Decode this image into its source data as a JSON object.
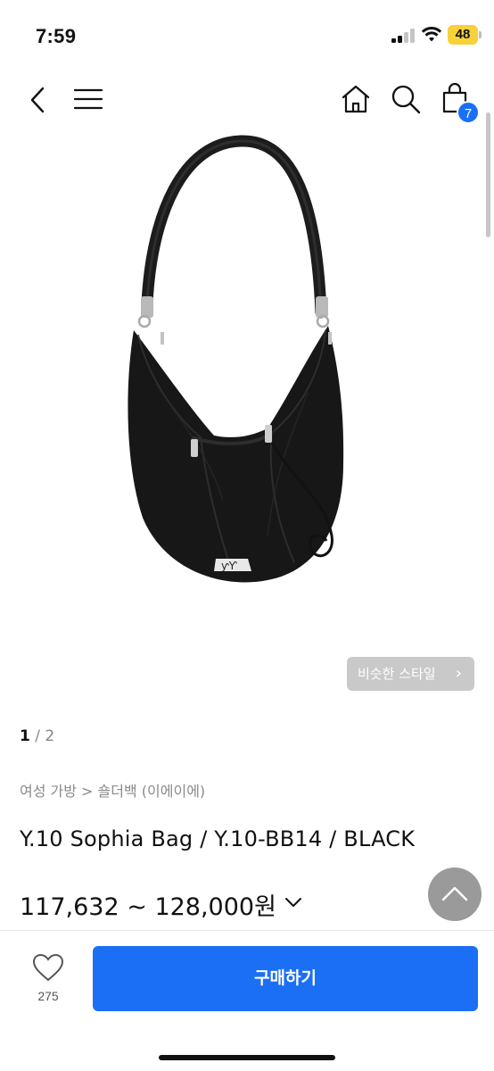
{
  "status_bar": {
    "time": "7:59",
    "battery": "48",
    "battery_color": "#f6d13a"
  },
  "nav": {
    "icons": [
      "back-icon",
      "menu-icon",
      "home-icon",
      "search-icon",
      "cart-icon"
    ],
    "cart_count": "7"
  },
  "gallery": {
    "image": "black-leather-drawstring-hobo-bag",
    "similar_label": "비슷한 스타일",
    "similar_chevron": "›",
    "page_current": "1",
    "page_separator": " / ",
    "page_total": "2"
  },
  "product": {
    "breadcrumb": "여성 가방 > 숄더백 (이에이에)",
    "title": "Y.10 Sophia Bag / Y.10-BB14 / BLACK",
    "price_range": "117,632 ~ 128,000원"
  },
  "bottom_bar": {
    "like_count": "275",
    "buy_label": "구매하기"
  },
  "colors": {
    "accent": "#1a6ff5",
    "badge": "#1a6ff5",
    "scroll_top_button": "#9a9a9a",
    "similar_button": "#c9c9c9"
  }
}
